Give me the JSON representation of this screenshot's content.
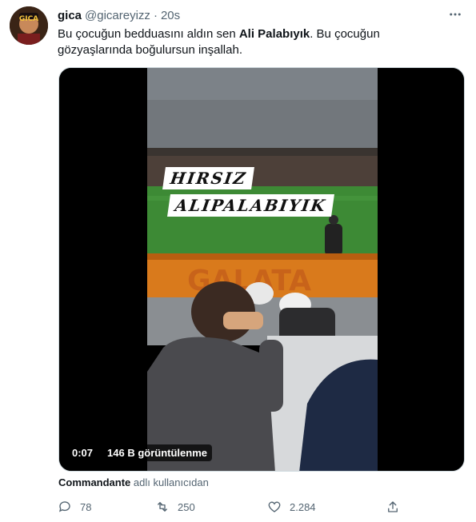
{
  "tweet": {
    "name": "gica",
    "handle": "@gicareyizz",
    "separator": "·",
    "time": "20s",
    "text_part1": "Bu çocuğun bedduasını aldın sen ",
    "text_bold": "Ali Palabıyık",
    "text_part2": ". Bu çocuğun gözyaşlarında boğulursun inşallah.",
    "avatar_label": "GICA"
  },
  "media": {
    "overlay_text_1": "HIRSIZ",
    "overlay_text_2": "ALIPALABIYIK",
    "banner_text": "GALATA",
    "duration": "0:07",
    "views": "146 B görüntülenme"
  },
  "attribution": {
    "user": "Commandante",
    "suffix": "adlı kullanıcıdan"
  },
  "actions": {
    "replies": "78",
    "retweets": "250",
    "likes": "2.284"
  },
  "colors": {
    "text": "#0f1419",
    "secondary": "#536471",
    "pitch": "#3d8a35",
    "banner": "#d97a1c"
  }
}
